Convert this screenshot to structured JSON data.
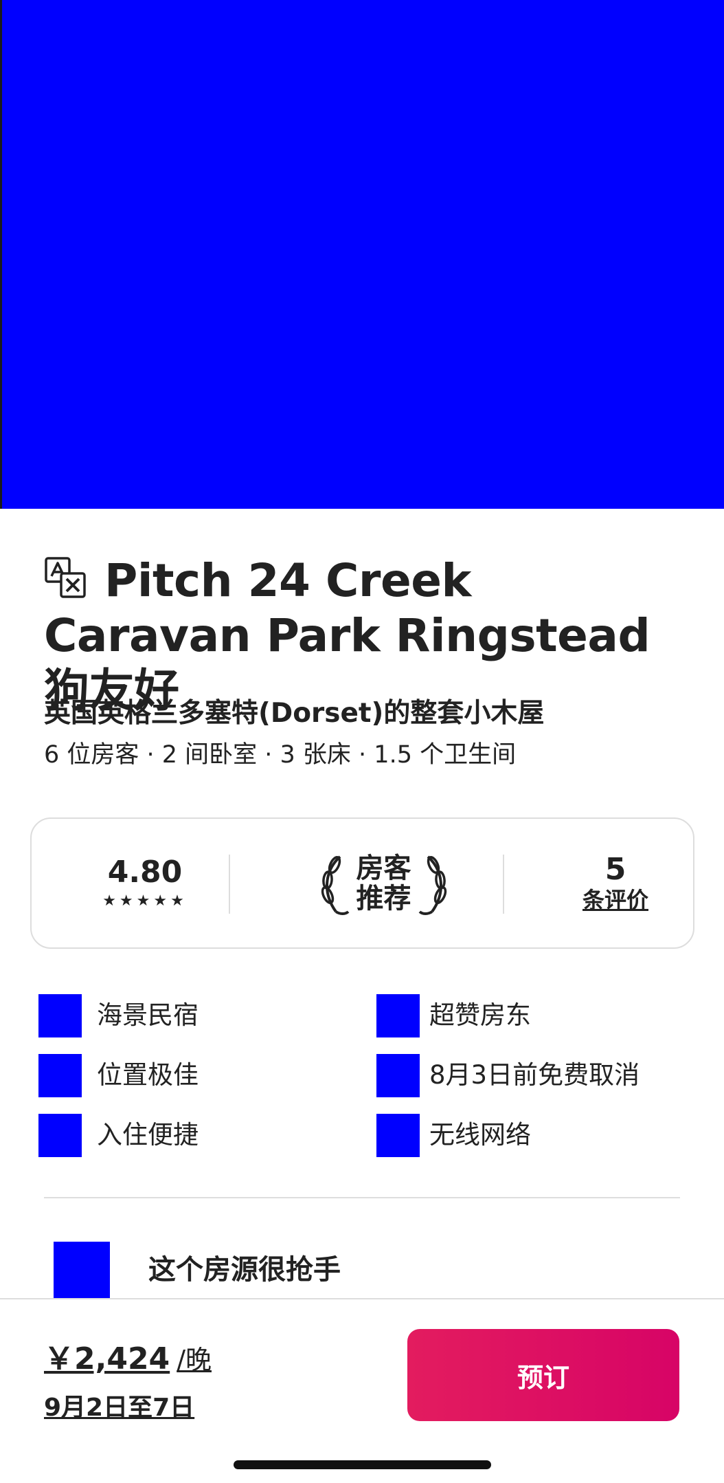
{
  "listing": {
    "title": "Pitch 24 Creek Caravan Park Ringstead狗友好",
    "subtitle": "英国英格兰多塞特(Dorset)的整套小木屋",
    "details": "6 位房客 · 2 间卧室 · 3 张床 · 1.5 个卫生间"
  },
  "rating_card": {
    "score": "4.80",
    "stars": "★★★★★",
    "guest_favorite_line1": "房客",
    "guest_favorite_line2": "推荐",
    "review_count": "5",
    "review_label": "条评价"
  },
  "features": [
    {
      "label": "海景民宿",
      "icon": "feature-icon"
    },
    {
      "label": "超赞房东",
      "icon": "feature-icon"
    },
    {
      "label": "位置极佳",
      "icon": "feature-icon"
    },
    {
      "label": "8月3日前免费取消",
      "icon": "feature-icon"
    },
    {
      "label": "入住便捷",
      "icon": "feature-icon"
    },
    {
      "label": "无线网络",
      "icon": "feature-icon"
    }
  ],
  "highlight": {
    "text": "这个房源很抢手"
  },
  "booking": {
    "price": "￥2,424",
    "per_night": "/晚",
    "dates": "9月2日至7日",
    "reserve_label": "预订"
  },
  "colors": {
    "accent": "#e31c5f",
    "placeholder": "#0000ff",
    "text": "#222222",
    "border": "#dddddd"
  }
}
